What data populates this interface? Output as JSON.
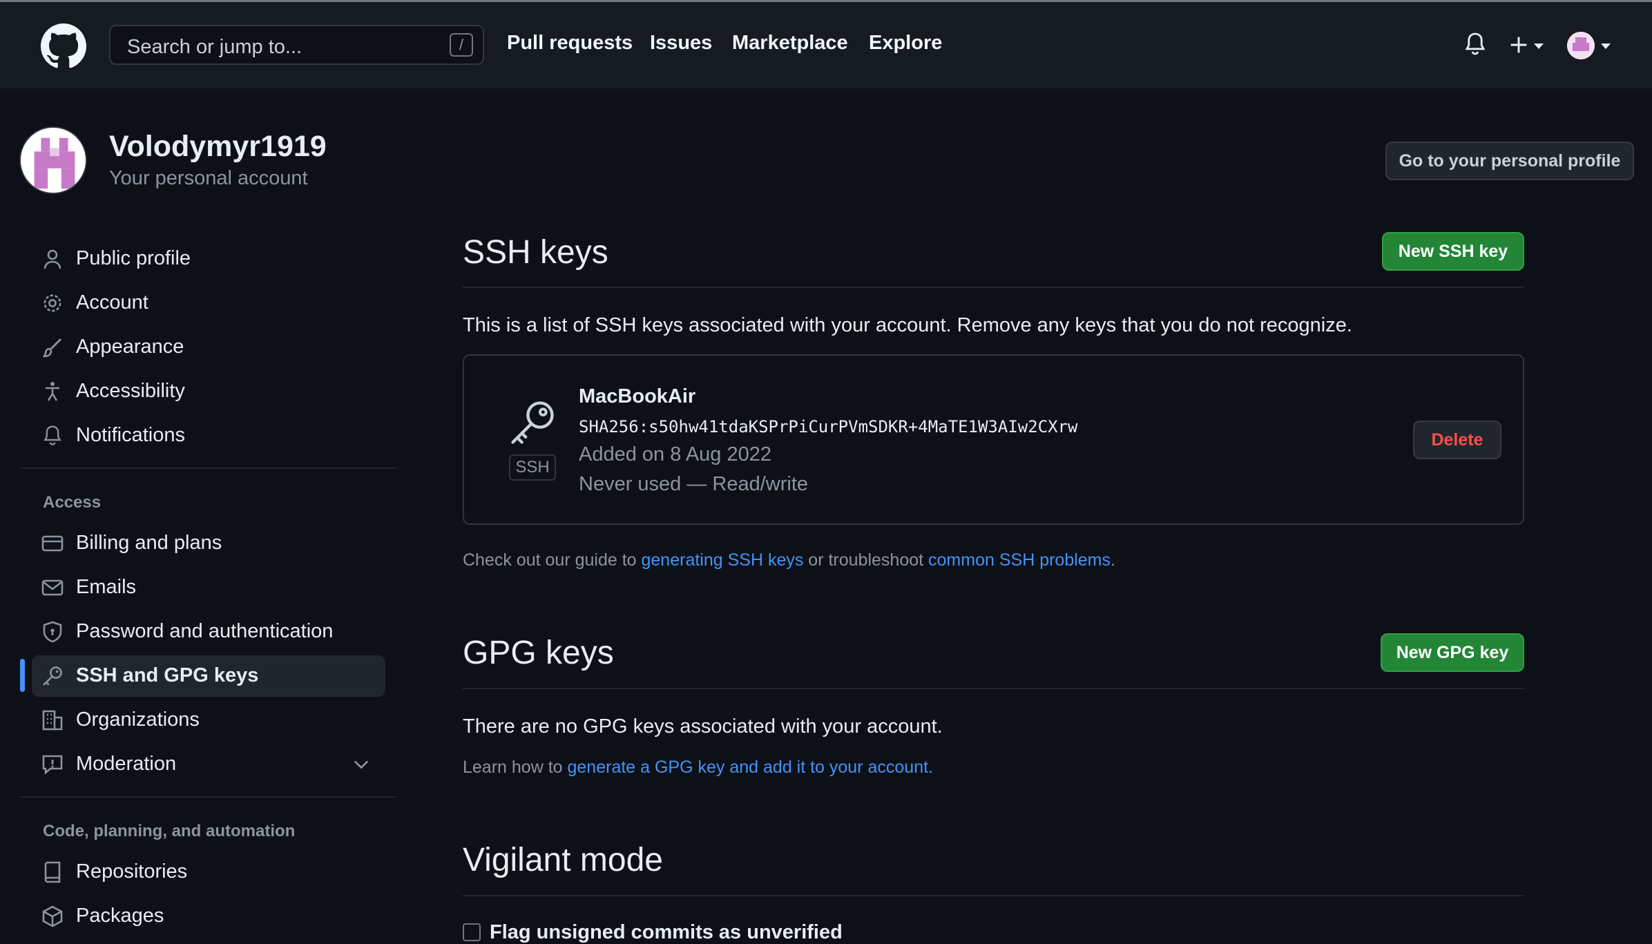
{
  "header": {
    "search_placeholder": "Search or jump to...",
    "search_shortcut": "/",
    "nav": [
      "Pull requests",
      "Issues",
      "Marketplace",
      "Explore"
    ]
  },
  "profile": {
    "username": "Volodymyr1919",
    "subtitle": "Your personal account",
    "go_profile_button": "Go to your personal profile"
  },
  "sidebar": {
    "items": [
      {
        "label": "Public profile",
        "icon": "person-icon"
      },
      {
        "label": "Account",
        "icon": "gear-icon"
      },
      {
        "label": "Appearance",
        "icon": "paintbrush-icon"
      },
      {
        "label": "Accessibility",
        "icon": "accessibility-icon"
      },
      {
        "label": "Notifications",
        "icon": "bell-icon"
      }
    ],
    "access_group": "Access",
    "access_items": [
      {
        "label": "Billing and plans",
        "icon": "credit-card-icon"
      },
      {
        "label": "Emails",
        "icon": "mail-icon"
      },
      {
        "label": "Password and authentication",
        "icon": "shield-icon"
      },
      {
        "label": "SSH and GPG keys",
        "icon": "key-icon"
      },
      {
        "label": "Organizations",
        "icon": "organization-icon"
      },
      {
        "label": "Moderation",
        "icon": "report-icon"
      }
    ],
    "code_group": "Code, planning, and automation",
    "code_items": [
      {
        "label": "Repositories",
        "icon": "repo-icon"
      },
      {
        "label": "Packages",
        "icon": "package-icon"
      }
    ]
  },
  "ssh": {
    "title": "SSH keys",
    "new_button": "New SSH key",
    "description": "This is a list of SSH keys associated with your account. Remove any keys that you do not recognize.",
    "key": {
      "name": "MacBookAir",
      "fingerprint": "SHA256:s50hw41tdaKSPrPiCurPVmSDKR+4MaTE1W3AIw2CXrw",
      "added": "Added on 8 Aug 2022",
      "usage": "Never used — Read/write",
      "badge": "SSH",
      "delete_button": "Delete"
    },
    "guide_prefix": "Check out our guide to ",
    "guide_link1": "generating SSH keys",
    "guide_middle": " or troubleshoot ",
    "guide_link2": "common SSH problems",
    "guide_suffix": "."
  },
  "gpg": {
    "title": "GPG keys",
    "new_button": "New GPG key",
    "empty_text": "There are no GPG keys associated with your account.",
    "learn_prefix": "Learn how to ",
    "learn_link": "generate a GPG key and add it to your account."
  },
  "vigilant": {
    "title": "Vigilant mode",
    "checkbox_label": "Flag unsigned commits as unverified"
  }
}
